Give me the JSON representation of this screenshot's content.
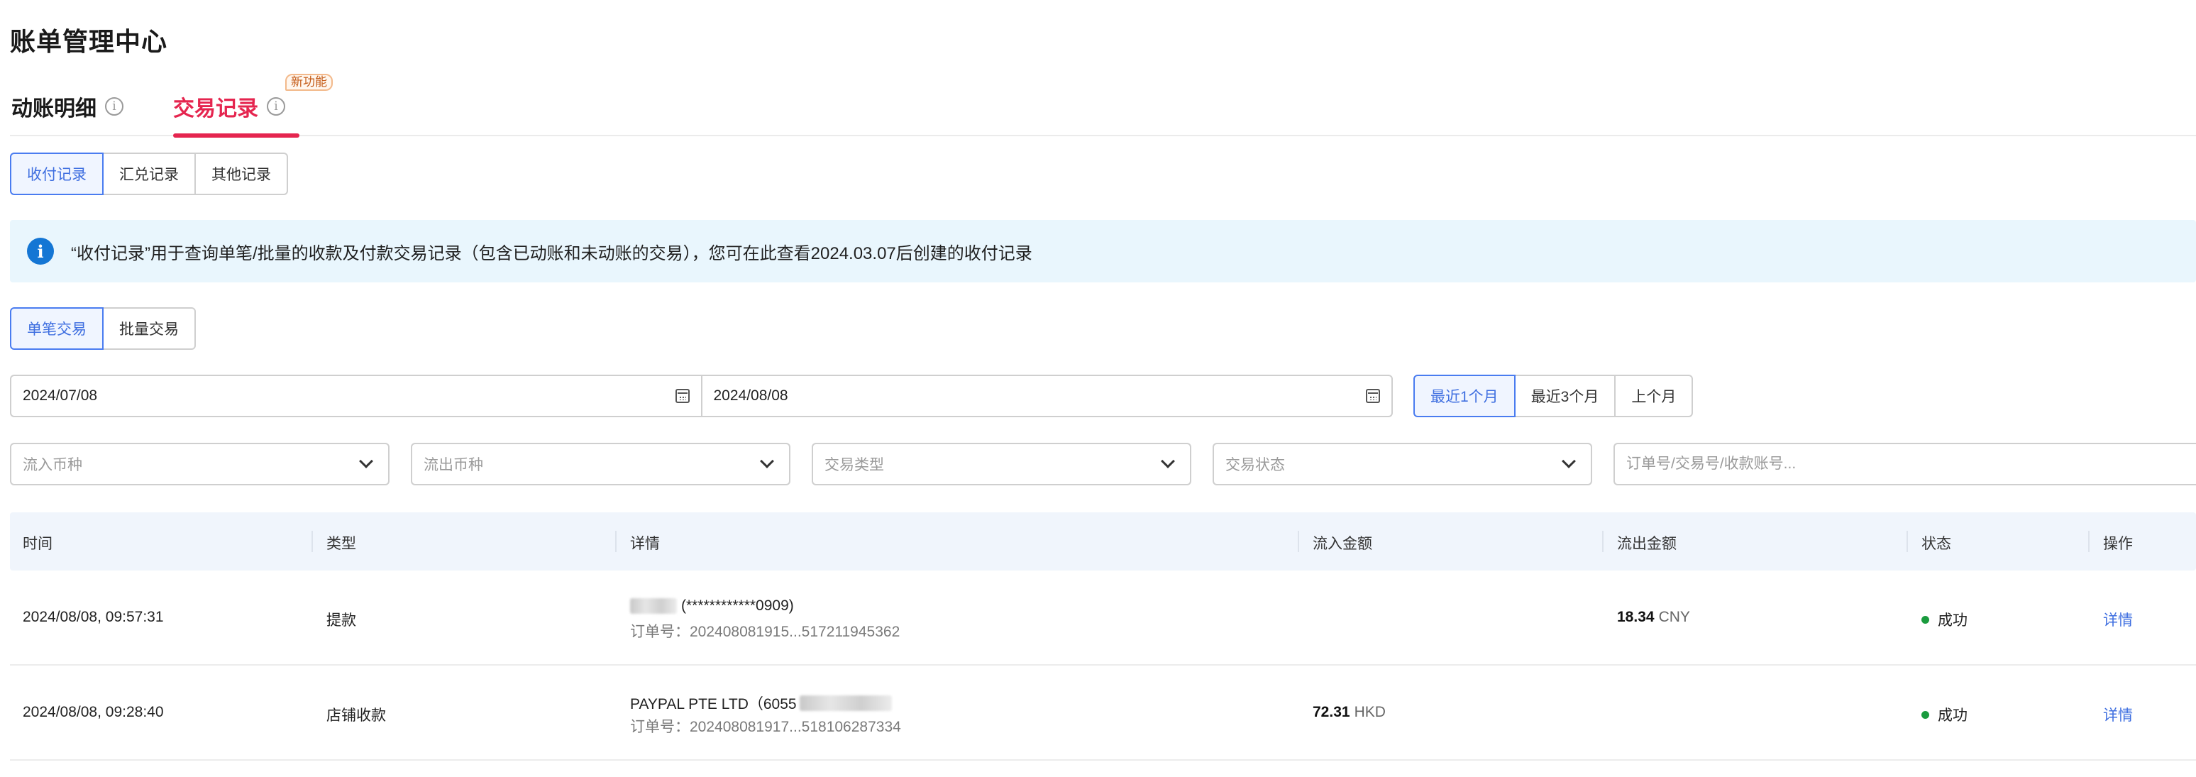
{
  "page_title": "账单管理中心",
  "tabs": [
    {
      "label": "动账明细",
      "active": false
    },
    {
      "label": "交易记录",
      "active": true,
      "badge": "新功能"
    }
  ],
  "record_types": [
    "收付记录",
    "汇兑记录",
    "其他记录"
  ],
  "record_type_selected": "收付记录",
  "notice": {
    "icon": "info-icon",
    "text": "“收付记录”用于查询单笔/批量的收款及付款交易记录（包含已动账和未动账的交易），您可在此查看2024.03.07后创建的收付记录"
  },
  "trade_modes": [
    "单笔交易",
    "批量交易"
  ],
  "trade_mode_selected": "单笔交易",
  "date_range": {
    "start": "2024/07/08",
    "end": "2024/08/08"
  },
  "quick_ranges": [
    "最近1个月",
    "最近3个月",
    "上个月"
  ],
  "quick_range_selected": "最近1个月",
  "filters": {
    "inflow_currency_placeholder": "流入币种",
    "outflow_currency_placeholder": "流出币种",
    "trade_type_placeholder": "交易类型",
    "trade_status_placeholder": "交易状态",
    "search_placeholder": "订单号/交易号/收款账号..."
  },
  "table": {
    "columns": [
      "时间",
      "类型",
      "详情",
      "流入金额",
      "流出金额",
      "状态",
      "操作"
    ],
    "rows": [
      {
        "time": "2024/08/08, 09:57:31",
        "type": "提款",
        "detail_line1": "(************0909)",
        "detail_line2": "订单号：202408081915...517211945362",
        "inflow_amount": "",
        "inflow_ccy": "",
        "outflow_amount": "18.34",
        "outflow_ccy": "CNY",
        "status": "成功",
        "action": "详情"
      },
      {
        "time": "2024/08/08, 09:28:40",
        "type": "店铺收款",
        "detail_line1": "PAYPAL PTE LTD（6055",
        "detail_line2": "订单号：202408081917...518106287334",
        "inflow_amount": "72.31",
        "inflow_ccy": "HKD",
        "outflow_amount": "",
        "outflow_ccy": "",
        "status": "成功",
        "action": "详情"
      }
    ]
  },
  "colors": {
    "accent_red": "#e5254f",
    "accent_blue": "#3f6fe0",
    "success_green": "#1a9b3e",
    "notice_bg": "#e9f6fd"
  }
}
